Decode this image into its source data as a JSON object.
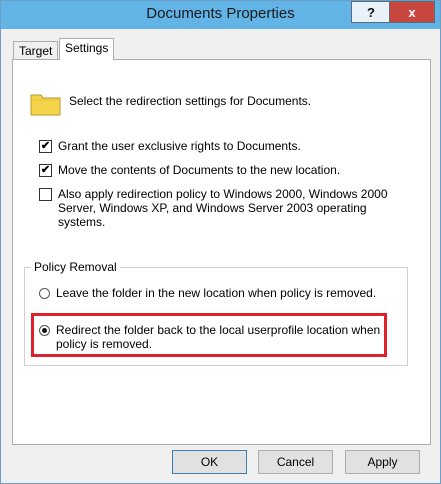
{
  "window": {
    "title": "Documents Properties",
    "help_label": "?",
    "close_label": "x"
  },
  "tabs": [
    {
      "label": "Target"
    },
    {
      "label": "Settings"
    }
  ],
  "settings": {
    "intro": "Select the redirection settings for Documents.",
    "options": [
      {
        "label": "Grant the user exclusive rights to Documents.",
        "checked": true,
        "mark": "✔"
      },
      {
        "label": "Move the contents of Documents to the new location.",
        "checked": true,
        "mark": "✔"
      },
      {
        "label_lines": [
          "Also apply redirection policy to Windows 2000, Windows 2000",
          "Server, Windows XP, and Windows Server 2003 operating",
          "systems."
        ],
        "checked": false,
        "mark": ""
      }
    ]
  },
  "policy_removal": {
    "legend": "Policy Removal",
    "choices": [
      {
        "lines": [
          "Leave the folder in the new location when policy is removed."
        ],
        "selected": false
      },
      {
        "lines": [
          "Redirect the folder back to the local userprofile location when",
          "policy is removed."
        ],
        "selected": true
      }
    ]
  },
  "buttons": {
    "ok": "OK",
    "cancel": "Cancel",
    "apply": "Apply"
  },
  "colors": {
    "titlebar": "#62b4e6",
    "close_button": "#c8473f",
    "highlight": "#e0202a"
  },
  "icons": {
    "folder": "folder-icon"
  }
}
